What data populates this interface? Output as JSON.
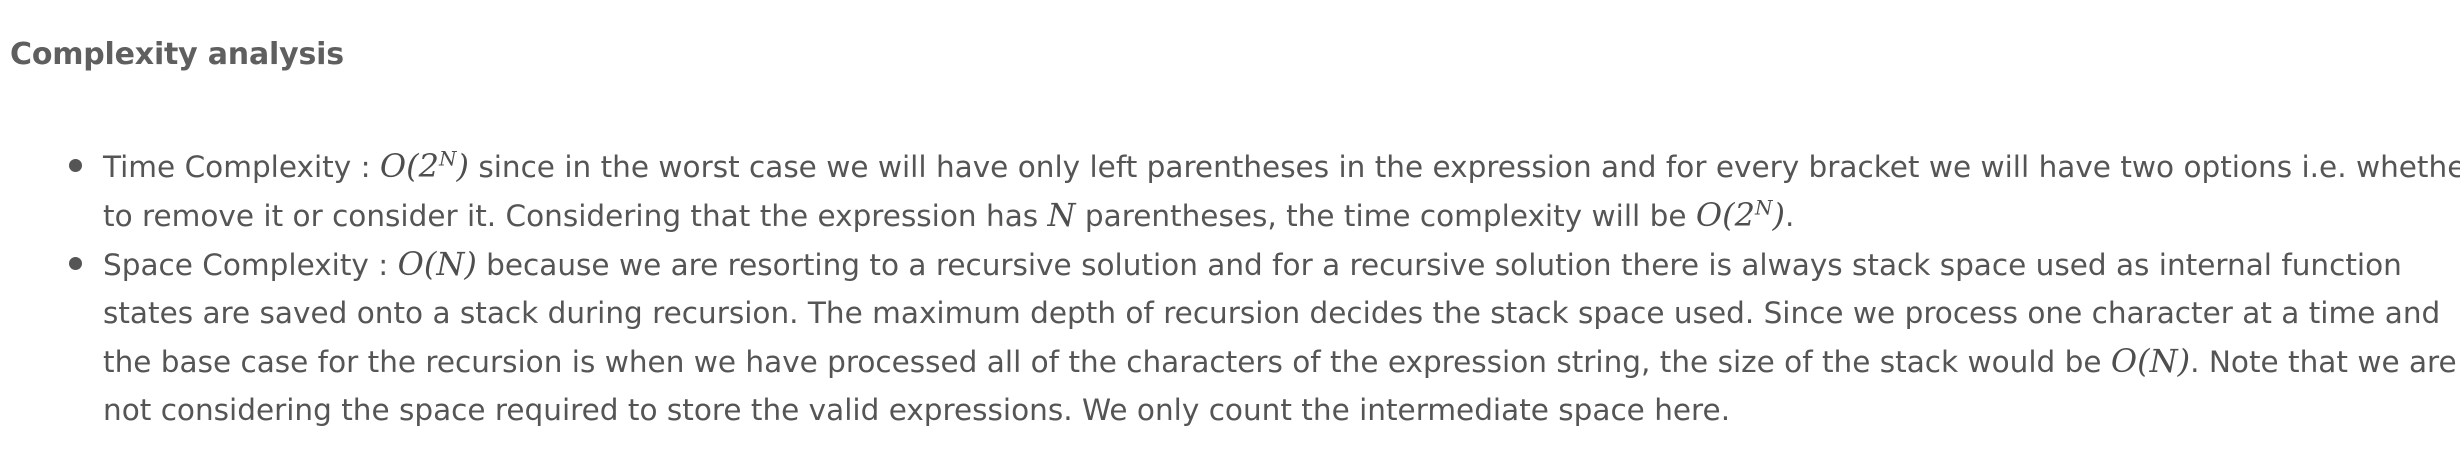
{
  "section": {
    "heading": "Complexity analysis"
  },
  "items": [
    {
      "label": "Time Complexity : ",
      "formula_main": "O(2",
      "formula_sup": "N",
      "formula_end": ")",
      "line1_rest": " since in the worst case we will have only left parentheses in the expression and for every bracket we will have two options i.e. whether",
      "line2_a": "to remove it or consider it. Considering that the expression has ",
      "var_n": "N",
      "line2_b": " parentheses, the time complexity will be ",
      "formula2_main": "O(2",
      "formula2_sup": "N",
      "formula2_end": ")",
      "line2_end": "."
    },
    {
      "label": "Space Complexity : ",
      "formula": "O(N)",
      "line1_rest": " because we are resorting to a recursive solution and for a recursive solution there is always stack space used as internal function",
      "line2": "states are saved onto a stack during recursion. The maximum depth of recursion decides the stack space used. Since we process one character at a time and",
      "line3_a": "the base case for the recursion is when we have processed all of the characters of the expression string, the size of the stack would be ",
      "formula2": "O(N)",
      "line3_b": ". Note that we are",
      "line4": "not considering the space required to store the valid expressions. We only count the intermediate space here."
    }
  ]
}
